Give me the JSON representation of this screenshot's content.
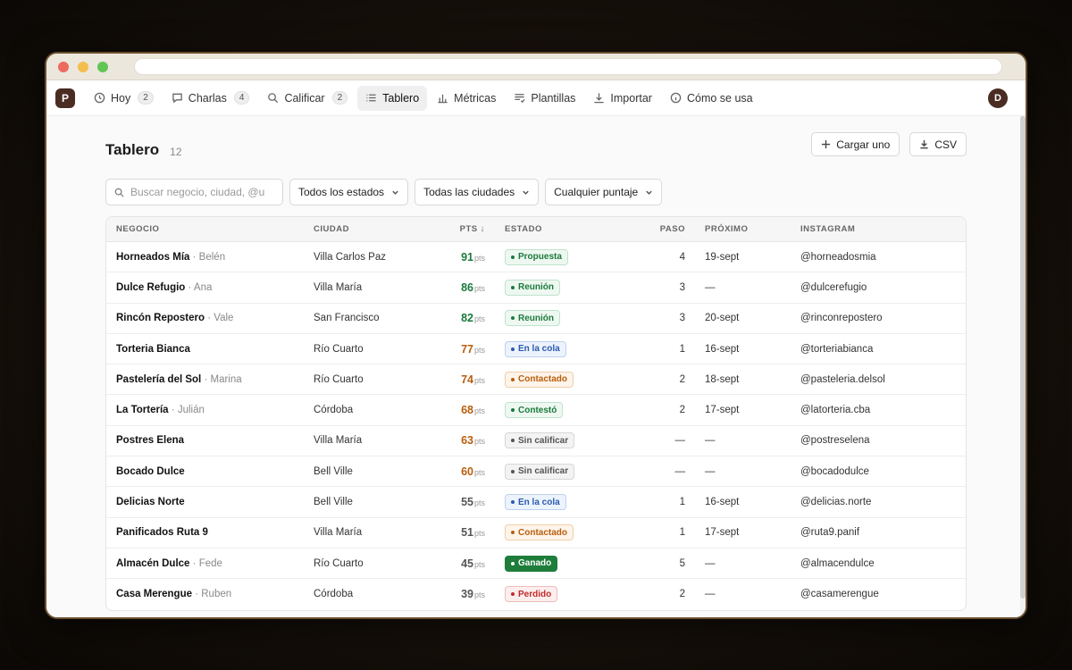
{
  "nav": {
    "logo": "P",
    "items": [
      {
        "label": "Hoy",
        "count": "2",
        "icon": "clock-icon",
        "active": false
      },
      {
        "label": "Charlas",
        "count": "4",
        "icon": "chat-icon",
        "active": false
      },
      {
        "label": "Calificar",
        "count": "2",
        "icon": "search-icon",
        "active": false
      },
      {
        "label": "Tablero",
        "count": "",
        "icon": "list-icon",
        "active": true
      },
      {
        "label": "Métricas",
        "count": "",
        "icon": "bar-chart-icon",
        "active": false
      },
      {
        "label": "Plantillas",
        "count": "",
        "icon": "lines-icon",
        "active": false
      },
      {
        "label": "Importar",
        "count": "",
        "icon": "download-icon",
        "active": false
      },
      {
        "label": "Cómo se usa",
        "count": "",
        "icon": "info-icon",
        "active": false
      }
    ],
    "avatar": "D"
  },
  "page": {
    "title": "Tablero",
    "count": "12",
    "upload_label": "Cargar uno",
    "csv_label": "CSV"
  },
  "filters": {
    "search_placeholder": "Buscar negocio, ciudad, @usuario",
    "status": "Todos los estados",
    "city": "Todas las ciudades",
    "score": "Cualquier puntaje"
  },
  "table": {
    "headers": [
      "NEGOCIO",
      "CIUDAD",
      "PTS ↓",
      "ESTADO",
      "PASO",
      "PRÓXIMO",
      "INSTAGRAM"
    ],
    "pts_unit": "pts",
    "rows": [
      {
        "name": "Horneados Mía",
        "contact": "Belén",
        "city": "Villa Carlos Paz",
        "pts": "91",
        "tier": "hi",
        "status": "Propuesta",
        "status_style": "b-green",
        "step": "4",
        "next": "19-sept",
        "ig": "@horneadosmia"
      },
      {
        "name": "Dulce Refugio",
        "contact": "Ana",
        "city": "Villa María",
        "pts": "86",
        "tier": "hi",
        "status": "Reunión",
        "status_style": "b-green",
        "step": "3",
        "next": "—",
        "ig": "@dulcerefugio"
      },
      {
        "name": "Rincón Repostero",
        "contact": "Vale",
        "city": "San Francisco",
        "pts": "82",
        "tier": "hi",
        "status": "Reunión",
        "status_style": "b-green",
        "step": "3",
        "next": "20-sept",
        "ig": "@rinconrepostero"
      },
      {
        "name": "Torteria Bianca",
        "contact": "",
        "city": "Río Cuarto",
        "pts": "77",
        "tier": "mid",
        "status": "En la cola",
        "status_style": "b-blue",
        "step": "1",
        "next": "16-sept",
        "ig": "@torteriabianca"
      },
      {
        "name": "Pastelería del Sol",
        "contact": "Marina",
        "city": "Río Cuarto",
        "pts": "74",
        "tier": "mid",
        "status": "Contactado",
        "status_style": "b-orange",
        "step": "2",
        "next": "18-sept",
        "ig": "@pasteleria.delsol"
      },
      {
        "name": "La Tortería",
        "contact": "Julián",
        "city": "Córdoba",
        "pts": "68",
        "tier": "mid",
        "status": "Contestó",
        "status_style": "b-green",
        "step": "2",
        "next": "17-sept",
        "ig": "@latorteria.cba"
      },
      {
        "name": "Postres Elena",
        "contact": "",
        "city": "Villa María",
        "pts": "63",
        "tier": "mid",
        "status": "Sin calificar",
        "status_style": "b-gray",
        "step": "—",
        "next": "—",
        "ig": "@postreselena"
      },
      {
        "name": "Bocado Dulce",
        "contact": "",
        "city": "Bell Ville",
        "pts": "60",
        "tier": "mid",
        "status": "Sin calificar",
        "status_style": "b-gray",
        "step": "—",
        "next": "—",
        "ig": "@bocadodulce"
      },
      {
        "name": "Delicias Norte",
        "contact": "",
        "city": "Bell Ville",
        "pts": "55",
        "tier": "lo",
        "status": "En la cola",
        "status_style": "b-blue",
        "step": "1",
        "next": "16-sept",
        "ig": "@delicias.norte"
      },
      {
        "name": "Panificados Ruta 9",
        "contact": "",
        "city": "Villa María",
        "pts": "51",
        "tier": "lo",
        "status": "Contactado",
        "status_style": "b-orange",
        "step": "1",
        "next": "17-sept",
        "ig": "@ruta9.panif"
      },
      {
        "name": "Almacén Dulce",
        "contact": "Fede",
        "city": "Río Cuarto",
        "pts": "45",
        "tier": "lo",
        "status": "Ganado",
        "status_style": "b-won",
        "step": "5",
        "next": "—",
        "ig": "@almacendulce"
      },
      {
        "name": "Casa Merengue",
        "contact": "Ruben",
        "city": "Córdoba",
        "pts": "39",
        "tier": "lo",
        "status": "Perdido",
        "status_style": "b-red",
        "step": "2",
        "next": "—",
        "ig": "@casamerengue"
      }
    ]
  }
}
